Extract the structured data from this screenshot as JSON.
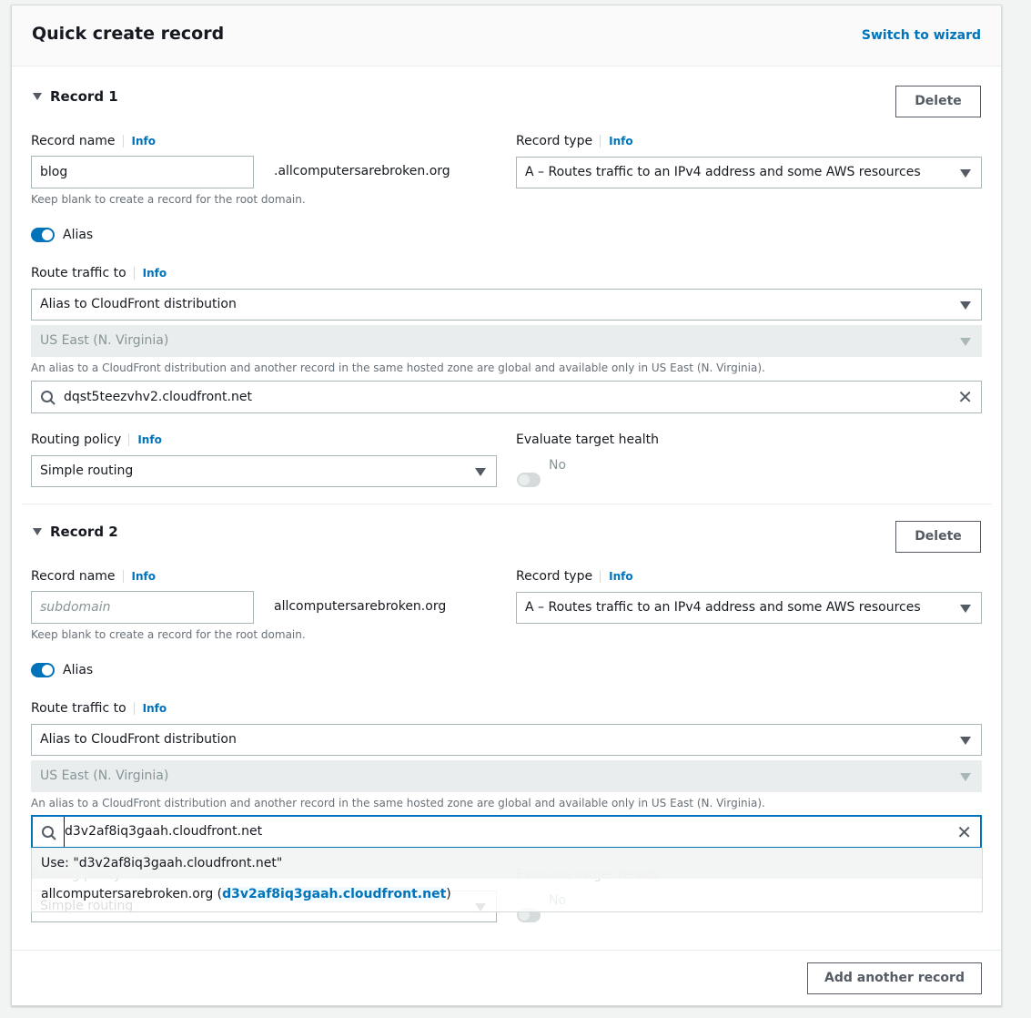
{
  "header": {
    "title": "Quick create record",
    "switch_link": "Switch to wizard"
  },
  "labels": {
    "record_name": "Record name",
    "record_type": "Record type",
    "info": "Info",
    "hint_root": "Keep blank to create a record for the root domain.",
    "alias": "Alias",
    "route_traffic": "Route traffic to",
    "alias_note": "An alias to a CloudFront distribution and another record in the same hosted zone are global and available only in US East (N. Virginia).",
    "routing_policy": "Routing policy",
    "evaluate_health": "Evaluate target health",
    "no": "No",
    "delete": "Delete"
  },
  "records": [
    {
      "title": "Record 1",
      "name_value": "blog",
      "name_placeholder": "subdomain",
      "suffix": ".allcomputersarebroken.org",
      "type": "A – Routes traffic to an IPv4 address and some AWS resources",
      "alias_on": true,
      "route_to": "Alias to CloudFront distribution",
      "region": "US East (N. Virginia)",
      "target": "dqst5teezvhv2.cloudfront.net",
      "routing_policy": "Simple routing",
      "evaluate_health_on": false
    },
    {
      "title": "Record 2",
      "name_value": "",
      "name_placeholder": "subdomain",
      "suffix": "allcomputersarebroken.org",
      "type": "A – Routes traffic to an IPv4 address and some AWS resources",
      "alias_on": true,
      "route_to": "Alias to CloudFront distribution",
      "region": "US East (N. Virginia)",
      "target": "d3v2af8iq3gaah.cloudfront.net",
      "routing_policy": "Simple routing",
      "evaluate_health_on": false
    }
  ],
  "dropdown": {
    "use_option": "Use: \"d3v2af8iq3gaah.cloudfront.net\"",
    "option_prefix": "allcomputersarebroken.org (",
    "option_match": "d3v2af8iq3gaah.cloudfront.net",
    "option_suffix": ")"
  },
  "footer": {
    "add_record": "Add another record"
  },
  "colors": {
    "accent": "#0073bb",
    "border": "#aab7b8"
  }
}
